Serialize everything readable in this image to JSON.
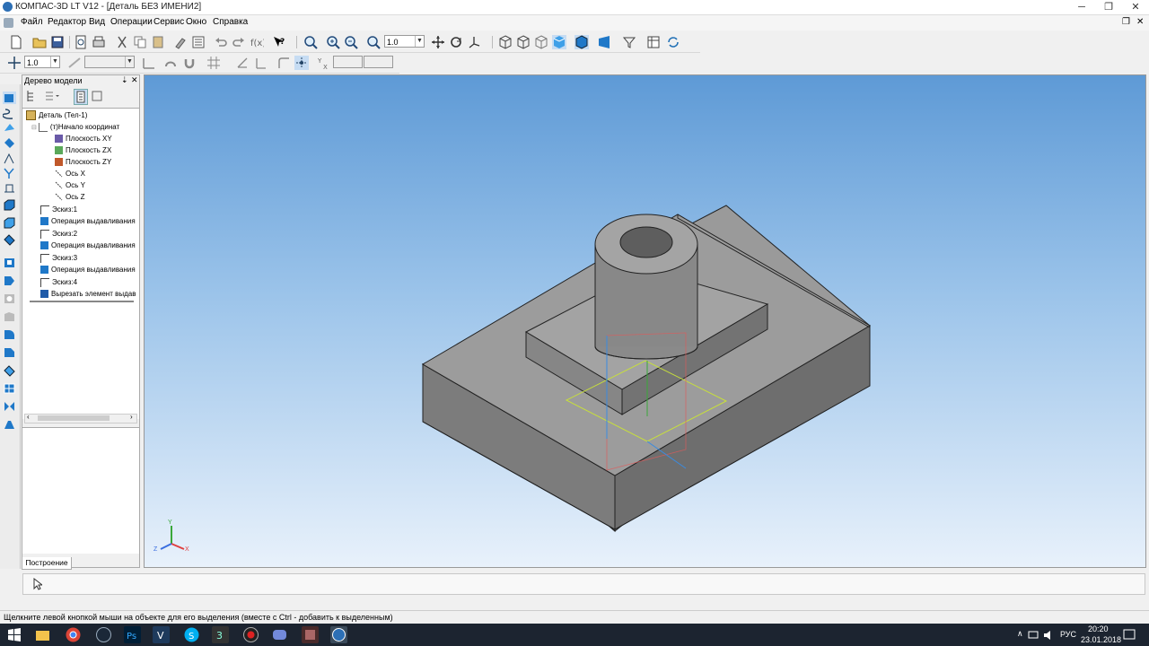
{
  "window": {
    "title": "КОМПАС-3D LT V12 - [Деталь БЕЗ ИМЕНИ2]",
    "minimize": "─",
    "restore": "❐",
    "close": "✕"
  },
  "menu": {
    "items": [
      "Файл",
      "Редактор",
      "Вид",
      "Операции",
      "Сервис",
      "Окно",
      "Справка"
    ],
    "doc_restore": "❐",
    "doc_close": "✕"
  },
  "toolbar1": {
    "zoom_value": "1.0"
  },
  "toolbar2": {
    "step_value": "1.0"
  },
  "tree": {
    "title": "Дерево модели",
    "pin": "⇣",
    "close": "✕",
    "items": [
      {
        "label": "Деталь (Тел-1)",
        "icon": "part-icon"
      },
      {
        "label": "(т)Начало координат",
        "icon": "origin-icon"
      },
      {
        "label": "Плоскость XY",
        "icon": "plane-xy-icon"
      },
      {
        "label": "Плоскость ZX",
        "icon": "plane-zx-icon"
      },
      {
        "label": "Плоскость ZY",
        "icon": "plane-zy-icon"
      },
      {
        "label": "Ось X",
        "icon": "axis-icon"
      },
      {
        "label": "Ось Y",
        "icon": "axis-icon"
      },
      {
        "label": "Ось Z",
        "icon": "axis-icon"
      },
      {
        "label": "Эскиз:1",
        "icon": "sketch-icon"
      },
      {
        "label": "Операция выдавливания",
        "icon": "extrude-icon"
      },
      {
        "label": "Эскиз:2",
        "icon": "sketch-icon"
      },
      {
        "label": "Операция выдавливания",
        "icon": "extrude-icon"
      },
      {
        "label": "Эскиз:3",
        "icon": "sketch-icon"
      },
      {
        "label": "Операция выдавливания",
        "icon": "extrude-icon"
      },
      {
        "label": "Эскиз:4",
        "icon": "sketch-icon"
      },
      {
        "label": "Вырезать элемент выдав",
        "icon": "cut-icon"
      }
    ],
    "tab_label": "Построение"
  },
  "viewport": {
    "axis_labels": {
      "x": "X",
      "y": "Y",
      "z": "Z"
    },
    "body_color": "#8c8c8c"
  },
  "status": {
    "message": "Щелкните левой кнопкой мыши на объекте для его выделения (вместе с Ctrl - добавить к выделенным)"
  },
  "taskbar": {
    "lang": "РУС",
    "time": "20:20",
    "date": "23.01.2018",
    "tray_chevron": "∧"
  }
}
